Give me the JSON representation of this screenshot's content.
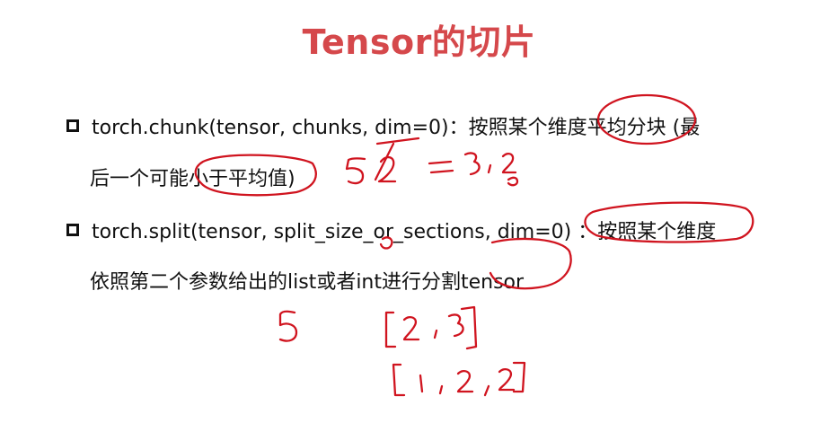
{
  "title": "Tensor的切片",
  "bullets": [
    {
      "line1": "torch.chunk(tensor, chunks, dim=0)：按照某个维度平均分块 (最",
      "line2": "后一个可能小于平均值)"
    },
    {
      "line1": "torch.split(tensor, split_size_or_sections, dim=0) ：按照某个维度",
      "line2": "依照第二个参数给出的list或者int进行分割tensor"
    }
  ],
  "handwriting_color": "#d0141f",
  "title_color": "#d5484b"
}
